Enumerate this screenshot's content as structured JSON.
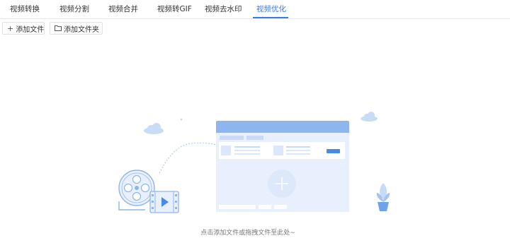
{
  "tabs": [
    {
      "label": "视频转换"
    },
    {
      "label": "视频分割"
    },
    {
      "label": "视频合并"
    },
    {
      "label": "视频转GIF"
    },
    {
      "label": "视频去水印"
    },
    {
      "label": "视频优化",
      "active": true
    }
  ],
  "toolbar": {
    "add_file_label": "添加文件",
    "add_folder_label": "添加文件夹",
    "add_file_icon": "plus-icon",
    "add_folder_icon": "folder-icon"
  },
  "empty_state": {
    "hint": "点击添加文件或拖拽文件至此处~"
  },
  "colors": {
    "accent": "#3a7be0",
    "illustration_light": "#e8f0fd",
    "illustration_mid": "#c7dbf8",
    "illustration_dark": "#8db6ee"
  }
}
